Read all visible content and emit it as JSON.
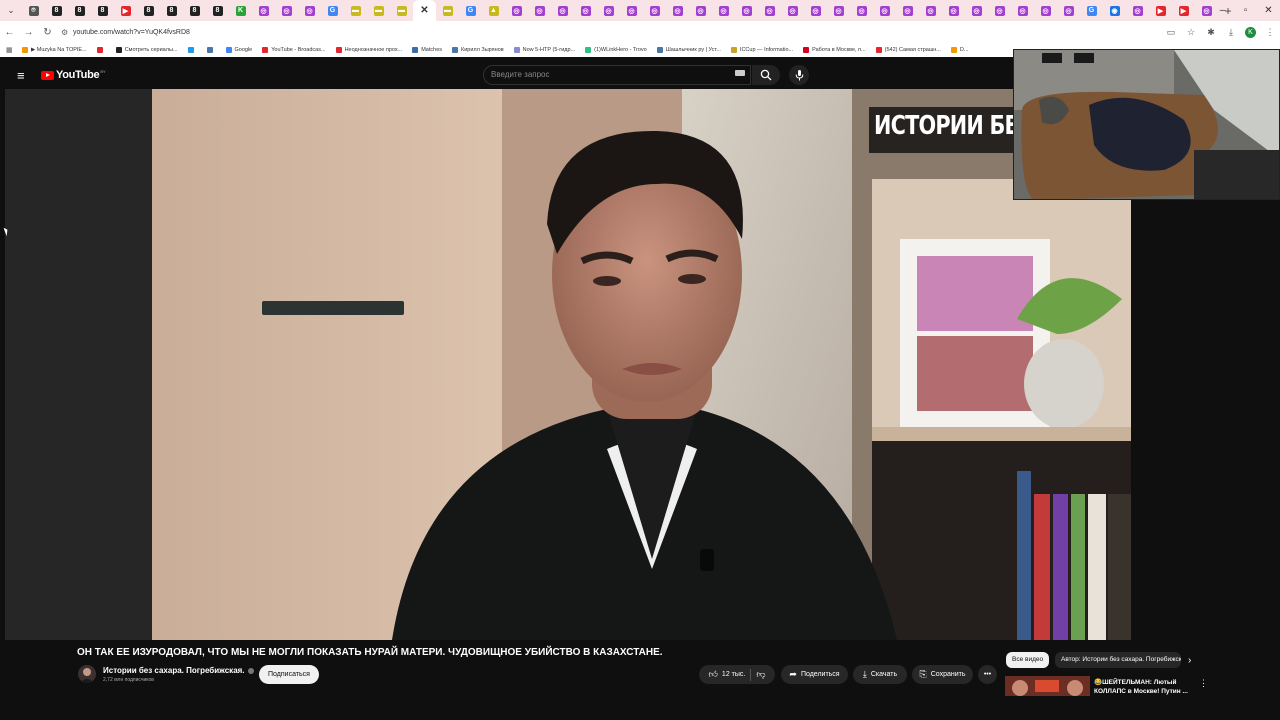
{
  "browser": {
    "tab_icons": [
      {
        "color": "#555555",
        "glyph": "⌾"
      },
      {
        "color": "#222222",
        "glyph": "8"
      },
      {
        "color": "#222222",
        "glyph": "8"
      },
      {
        "color": "#222222",
        "glyph": "8"
      },
      {
        "color": "#e4262d",
        "glyph": "▶"
      },
      {
        "color": "#222222",
        "glyph": "8"
      },
      {
        "color": "#222222",
        "glyph": "8"
      },
      {
        "color": "#222222",
        "glyph": "8"
      },
      {
        "color": "#222222",
        "glyph": "8"
      },
      {
        "color": "#29a33a",
        "glyph": "K"
      },
      {
        "color": "#a23fd1",
        "glyph": "◎"
      },
      {
        "color": "#a23fd1",
        "glyph": "◎"
      },
      {
        "color": "#a23fd1",
        "glyph": "◎"
      },
      {
        "color": "#4285f4",
        "glyph": "G"
      },
      {
        "color": "#c9b91f",
        "glyph": "▬"
      },
      {
        "color": "#c9b91f",
        "glyph": "▬"
      },
      {
        "color": "#c9b91f",
        "glyph": "▬"
      },
      {
        "color": "#ffffff",
        "glyph": "✕",
        "active": true
      },
      {
        "color": "#c9b91f",
        "glyph": "▬"
      },
      {
        "color": "#4285f4",
        "glyph": "G"
      },
      {
        "color": "#c9b91f",
        "glyph": "▲"
      },
      {
        "color": "#a23fd1",
        "glyph": "◎"
      },
      {
        "color": "#a23fd1",
        "glyph": "◎"
      },
      {
        "color": "#a23fd1",
        "glyph": "◎"
      },
      {
        "color": "#a23fd1",
        "glyph": "◎"
      },
      {
        "color": "#a23fd1",
        "glyph": "◎"
      },
      {
        "color": "#a23fd1",
        "glyph": "◎"
      },
      {
        "color": "#a23fd1",
        "glyph": "◎"
      },
      {
        "color": "#a23fd1",
        "glyph": "◎"
      },
      {
        "color": "#a23fd1",
        "glyph": "◎"
      },
      {
        "color": "#a23fd1",
        "glyph": "◎"
      },
      {
        "color": "#a23fd1",
        "glyph": "◎"
      },
      {
        "color": "#a23fd1",
        "glyph": "◎"
      },
      {
        "color": "#a23fd1",
        "glyph": "◎"
      },
      {
        "color": "#a23fd1",
        "glyph": "◎"
      },
      {
        "color": "#a23fd1",
        "glyph": "◎"
      },
      {
        "color": "#a23fd1",
        "glyph": "◎"
      },
      {
        "color": "#a23fd1",
        "glyph": "◎"
      },
      {
        "color": "#a23fd1",
        "glyph": "◎"
      },
      {
        "color": "#a23fd1",
        "glyph": "◎"
      },
      {
        "color": "#a23fd1",
        "glyph": "◎"
      },
      {
        "color": "#a23fd1",
        "glyph": "◎"
      },
      {
        "color": "#a23fd1",
        "glyph": "◎"
      },
      {
        "color": "#a23fd1",
        "glyph": "◎"
      },
      {
        "color": "#a23fd1",
        "glyph": "◎"
      },
      {
        "color": "#a23fd1",
        "glyph": "◎"
      },
      {
        "color": "#4285f4",
        "glyph": "G"
      },
      {
        "color": "#1a73e8",
        "glyph": "◉"
      },
      {
        "color": "#a23fd1",
        "glyph": "◎"
      },
      {
        "color": "#e4262d",
        "glyph": "▶"
      },
      {
        "color": "#e4262d",
        "glyph": "▶"
      },
      {
        "color": "#a23fd1",
        "glyph": "◎"
      }
    ],
    "new_tab": "+",
    "url": "youtube.com/watch?v=YuQK4fvsRD8",
    "profile_initial": "K",
    "bookmarks": [
      {
        "label": "▶ Muzyka Na TOPIE...",
        "color": "#f29900"
      },
      {
        "label": "",
        "color": "#e4262d"
      },
      {
        "label": "Смотреть сериалы...",
        "color": "#222222"
      },
      {
        "label": "",
        "color": "#1d9bf0"
      },
      {
        "label": "",
        "color": "#4a76a8"
      },
      {
        "label": "Google",
        "color": "#4285f4"
      },
      {
        "label": "YouTube - Broadcas...",
        "color": "#e4262d"
      },
      {
        "label": "Неоднозначное прох...",
        "color": "#e4262d"
      },
      {
        "label": "Matches",
        "color": "#3c6ea8"
      },
      {
        "label": "Кирилл Зырянов",
        "color": "#4a76a8"
      },
      {
        "label": "Now 5-HTP (5-гидр...",
        "color": "#8a8ad0"
      },
      {
        "label": "(1)WLinkHero - Trovo",
        "color": "#2ec27e"
      },
      {
        "label": "Шашлычник ру | Уст...",
        "color": "#4a76a8"
      },
      {
        "label": "ICCup — Informatio...",
        "color": "#c9a227"
      },
      {
        "label": "Работа в Москве, п...",
        "color": "#d6001c"
      },
      {
        "label": "(542) Самая страшн...",
        "color": "#e4262d"
      },
      {
        "label": "D...",
        "color": "#f29900"
      }
    ]
  },
  "youtube": {
    "logo_text": "YouTube",
    "region": "BY",
    "search_placeholder": "Введите запрос",
    "video_overlay_text": "ИСТОРИИ БЕЗ",
    "title": "ОН ТАК ЕЕ ИЗУРОДОВАЛ, ЧТО МЫ НЕ МОГЛИ ПОКАЗАТЬ НУРАЙ МАТЕРИ. ЧУДОВИЩНОЕ УБИЙСТВО В КАЗАХСТАНЕ.",
    "channel_name": "Истории без сахара. Погребижская.",
    "subscribers": "2,72 млн подписчиков",
    "subscribe_label": "Подписаться",
    "likes": "12 тыс.",
    "share_label": "Поделиться",
    "download_label": "Скачать",
    "save_label": "Сохранить",
    "chips": {
      "all": "Все видео",
      "author": "Автор: Истории без сахара. Погребижская."
    },
    "recommendation_title": "😂ШЕЙТЕЛЬМАН: Лютый КОЛЛАПС в Москве! Путин ..."
  },
  "colors": {
    "youtube_red": "#ff0000",
    "background": "#0f0f0f",
    "tabstrip": "#f8e4e6"
  }
}
